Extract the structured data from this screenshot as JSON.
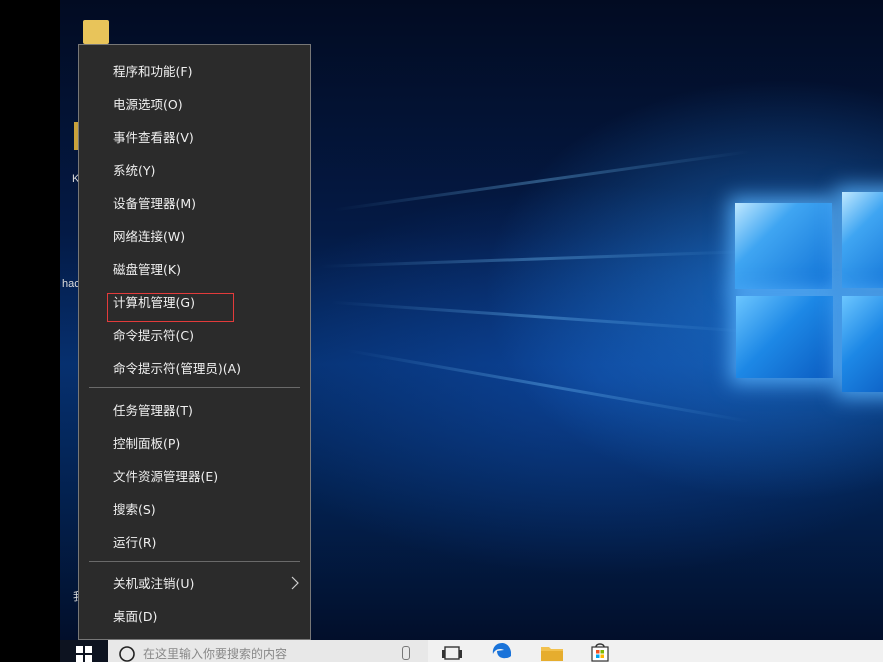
{
  "desktop": {
    "icon_labels": [
      "K",
      "hac",
      "我"
    ]
  },
  "context_menu": {
    "group1": [
      {
        "label": "程序和功能(F)"
      },
      {
        "label": "电源选项(O)"
      },
      {
        "label": "事件查看器(V)"
      },
      {
        "label": "系统(Y)"
      },
      {
        "label": "设备管理器(M)"
      },
      {
        "label": "网络连接(W)"
      },
      {
        "label": "磁盘管理(K)"
      },
      {
        "label": "计算机管理(G)",
        "highlighted": true
      },
      {
        "label": "命令提示符(C)"
      },
      {
        "label": "命令提示符(管理员)(A)"
      }
    ],
    "group2": [
      {
        "label": "任务管理器(T)"
      },
      {
        "label": "控制面板(P)"
      },
      {
        "label": "文件资源管理器(E)"
      },
      {
        "label": "搜索(S)"
      },
      {
        "label": "运行(R)"
      }
    ],
    "group3": [
      {
        "label": "关机或注销(U)",
        "has_submenu": true
      },
      {
        "label": "桌面(D)"
      }
    ],
    "highlight_color": "#e23b3b",
    "background_color": "#2b2b2b"
  },
  "taskbar": {
    "search_placeholder": "在这里输入你要搜索的内容",
    "icons": [
      "windows-start-icon",
      "search-icon",
      "microphone-icon",
      "task-view-icon",
      "edge-icon",
      "file-explorer-icon",
      "store-icon"
    ]
  }
}
